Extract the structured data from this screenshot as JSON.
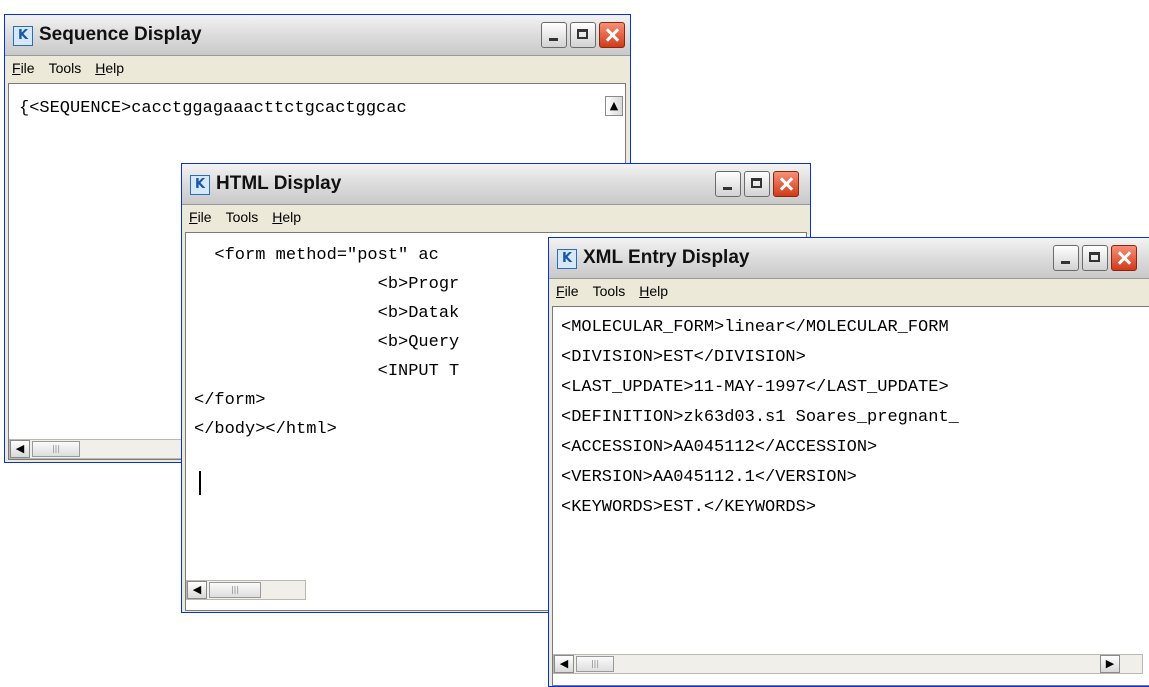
{
  "menu": {
    "file": "File",
    "tools": "Tools",
    "help": "Help"
  },
  "seq_window": {
    "title": "Sequence Display",
    "line": "{<SEQUENCE>cacctggagaaacttctgcactggcac"
  },
  "html_window": {
    "title": "HTML Display",
    "lines": [
      "  <form method=\"post\" ac",
      "                  <b>Progr",
      "                  <b>Datak",
      "                  <b>Query",
      "                  <INPUT T",
      "</form>",
      "</body></html>"
    ]
  },
  "xml_window": {
    "title": "XML Entry Display",
    "lines": [
      "<MOLECULAR_FORM>linear</MOLECULAR_FORM",
      "<DIVISION>EST</DIVISION>",
      "<LAST_UPDATE>11-MAY-1997</LAST_UPDATE>",
      "",
      "<DEFINITION>zk63d03.s1 Soares_pregnant_",
      "<ACCESSION>AA045112</ACCESSION>",
      "<VERSION>AA045112.1</VERSION>",
      "<KEYWORDS>EST.</KEYWORDS>"
    ]
  }
}
